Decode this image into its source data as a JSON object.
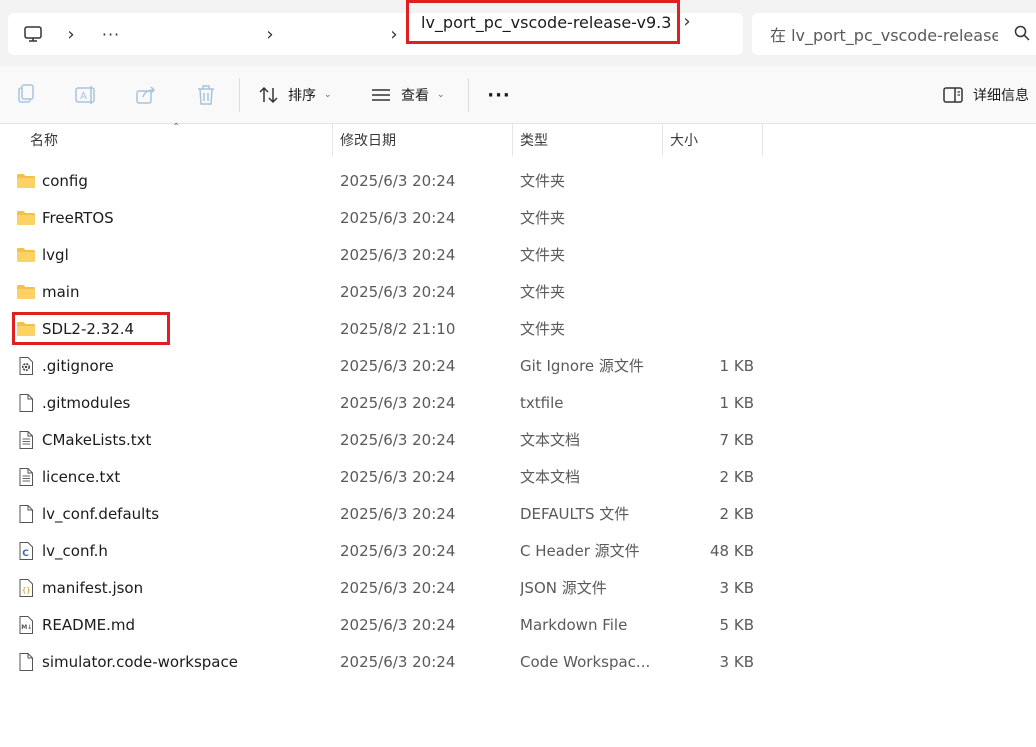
{
  "address_bar": {
    "ellipsis": "···",
    "current_folder": "lv_port_pc_vscode-release-v9.3",
    "separator": "›"
  },
  "search": {
    "placeholder": "在 lv_port_pc_vscode-release"
  },
  "toolbar": {
    "sort_label": "排序",
    "view_label": "查看",
    "more_label": "···",
    "details_label": "详细信息",
    "icons": [
      "copy-icon",
      "rename-icon",
      "share-icon",
      "delete-icon",
      "sort-icon",
      "view-icon",
      "details-pane-icon"
    ]
  },
  "columns": {
    "name": "名称",
    "modified": "修改日期",
    "type": "类型",
    "size": "大小"
  },
  "files": [
    {
      "name": "config",
      "modified": "2025/6/3 20:24",
      "type": "文件夹",
      "size": "",
      "icon": "folder"
    },
    {
      "name": "FreeRTOS",
      "modified": "2025/6/3 20:24",
      "type": "文件夹",
      "size": "",
      "icon": "folder"
    },
    {
      "name": "lvgl",
      "modified": "2025/6/3 20:24",
      "type": "文件夹",
      "size": "",
      "icon": "folder"
    },
    {
      "name": "main",
      "modified": "2025/6/3 20:24",
      "type": "文件夹",
      "size": "",
      "icon": "folder"
    },
    {
      "name": "SDL2-2.32.4",
      "modified": "2025/8/2 21:10",
      "type": "文件夹",
      "size": "",
      "icon": "folder"
    },
    {
      "name": ".gitignore",
      "modified": "2025/6/3 20:24",
      "type": "Git Ignore 源文件",
      "size": "1 KB",
      "icon": "gear-file"
    },
    {
      "name": ".gitmodules",
      "modified": "2025/6/3 20:24",
      "type": "txtfile",
      "size": "1 KB",
      "icon": "blank-file"
    },
    {
      "name": "CMakeLists.txt",
      "modified": "2025/6/3 20:24",
      "type": "文本文档",
      "size": "7 KB",
      "icon": "text-file"
    },
    {
      "name": "licence.txt",
      "modified": "2025/6/3 20:24",
      "type": "文本文档",
      "size": "2 KB",
      "icon": "text-file"
    },
    {
      "name": "lv_conf.defaults",
      "modified": "2025/6/3 20:24",
      "type": "DEFAULTS 文件",
      "size": "2 KB",
      "icon": "blank-file"
    },
    {
      "name": "lv_conf.h",
      "modified": "2025/6/3 20:24",
      "type": "C Header 源文件",
      "size": "48 KB",
      "icon": "c-file"
    },
    {
      "name": "manifest.json",
      "modified": "2025/6/3 20:24",
      "type": "JSON 源文件",
      "size": "3 KB",
      "icon": "json-file"
    },
    {
      "name": "README.md",
      "modified": "2025/6/3 20:24",
      "type": "Markdown File",
      "size": "5 KB",
      "icon": "markdown-file"
    },
    {
      "name": "simulator.code-workspace",
      "modified": "2025/6/3 20:24",
      "type": "Code Workspac...",
      "size": "3 KB",
      "icon": "blank-file"
    }
  ],
  "colors": {
    "highlight": "#e02020",
    "folder": "#f5c04a",
    "addressbar_bg": "#f3f3f3",
    "toolbar_bg": "#f9f9f9"
  }
}
